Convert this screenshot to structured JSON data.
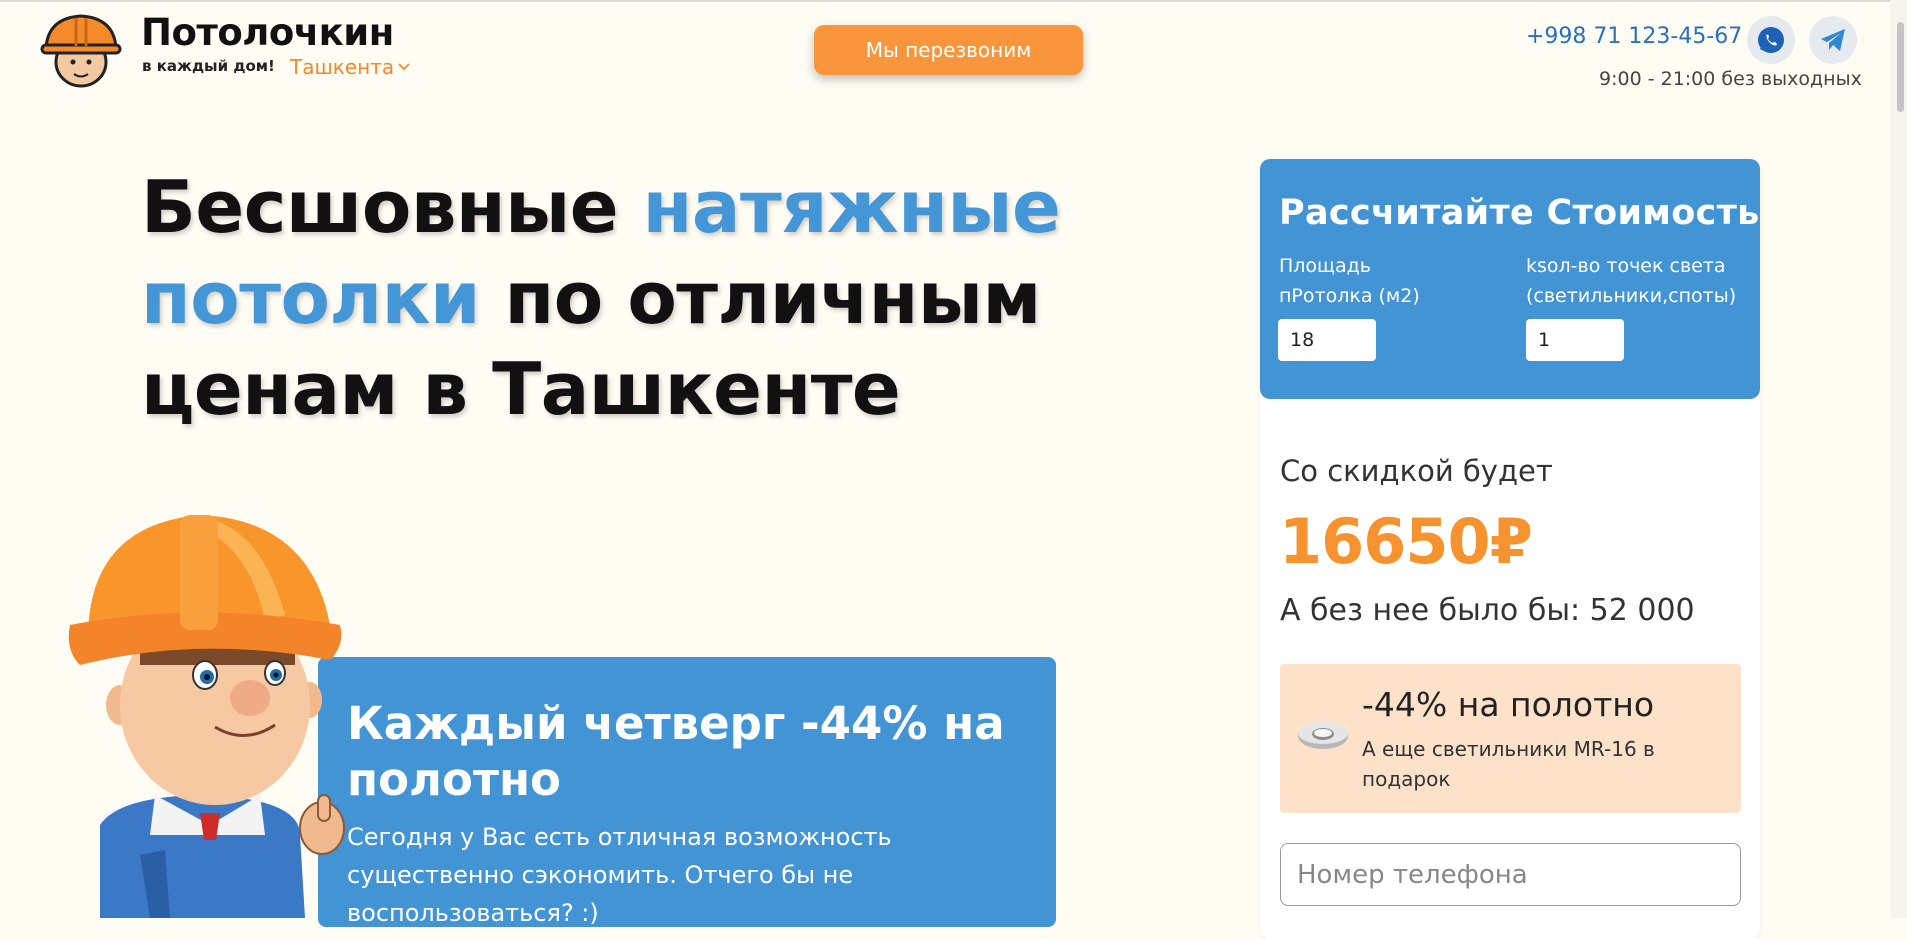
{
  "header": {
    "brand_name": "Потолочкин",
    "brand_tagline": "в каждый дом!",
    "city": "Ташкента",
    "callback_label": "Мы перезвоним",
    "phone": "+998 71 123-45-67",
    "hours": "9:00 - 21:00 без выходных",
    "messengers": [
      "whatsapp-icon",
      "telegram-icon"
    ]
  },
  "hero": {
    "headline_part1": "Бесшовные ",
    "headline_accent": "натяжные потолки",
    "headline_part2": " по отличным ценам в Ташкенте"
  },
  "promo": {
    "title": "Каждый четверг -44% на полотно",
    "text": "Сегодня у Вас есть отличная возможность существенно сэкономить. Отчего бы не воспользоваться? :)"
  },
  "calculator": {
    "title": "Рассчитайте Стоимость",
    "area_label": "Площадь пРотолка (м2)",
    "area_value": "18",
    "lights_label": "ksол-во точек света (светильники,споты)",
    "lights_value": "1",
    "discount_label": "Со скидкой будет",
    "price": "16650₽",
    "old_price": "А без нее было бы: 52 000",
    "offer_title": "-44% на полотно",
    "offer_text": "А еще светильники MR-16 в подарок",
    "phone_placeholder": "Номер телефона"
  },
  "colors": {
    "accent_blue": "#4294d5",
    "accent_orange": "#f9963b",
    "background": "#fefcf3"
  }
}
